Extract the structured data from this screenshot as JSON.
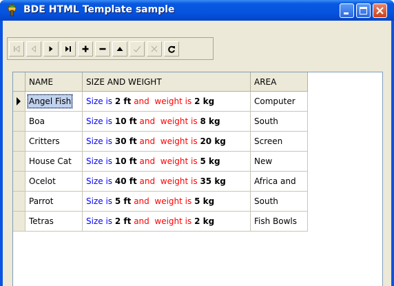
{
  "window": {
    "title": "BDE HTML Template sample"
  },
  "navigator": {
    "buttons": [
      {
        "name": "first-record-button",
        "icon": "first-icon",
        "enabled": false
      },
      {
        "name": "prior-record-button",
        "icon": "prior-icon",
        "enabled": false
      },
      {
        "name": "next-record-button",
        "icon": "next-icon",
        "enabled": true
      },
      {
        "name": "last-record-button",
        "icon": "last-icon",
        "enabled": true
      },
      {
        "name": "insert-record-button",
        "icon": "plus-icon",
        "enabled": true
      },
      {
        "name": "delete-record-button",
        "icon": "minus-icon",
        "enabled": true
      },
      {
        "name": "edit-record-button",
        "icon": "up-triangle-icon",
        "enabled": true
      },
      {
        "name": "post-record-button",
        "icon": "check-icon",
        "enabled": false
      },
      {
        "name": "cancel-edit-button",
        "icon": "x-icon",
        "enabled": false
      },
      {
        "name": "refresh-button",
        "icon": "refresh-icon",
        "enabled": true
      }
    ]
  },
  "grid": {
    "columns": [
      "NAME",
      "SIZE AND WEIGHT",
      "AREA"
    ],
    "size_label": "Size is",
    "weight_label": "and  weight is",
    "rows": [
      {
        "name": "Angel Fish",
        "size": "2 ft",
        "weight": "2 kg",
        "area": "Computer",
        "current": true
      },
      {
        "name": "Boa",
        "size": "10 ft",
        "weight": "8 kg",
        "area": "South"
      },
      {
        "name": "Critters",
        "size": "30 ft",
        "weight": "20 kg",
        "area": "Screen"
      },
      {
        "name": "House Cat",
        "size": "10 ft",
        "weight": "5 kg",
        "area": "New"
      },
      {
        "name": "Ocelot",
        "size": "40 ft",
        "weight": "35 kg",
        "area": "Africa and"
      },
      {
        "name": "Parrot",
        "size": "5 ft",
        "weight": "5 kg",
        "area": "South"
      },
      {
        "name": "Tetras",
        "size": "2 ft",
        "weight": "2 kg",
        "area": "Fish Bowls"
      }
    ]
  },
  "colors": {
    "size_label": "#0000ff",
    "weight_label": "#ff0000",
    "titlebar": "#0554e0",
    "selection": "#c1d2ee"
  }
}
